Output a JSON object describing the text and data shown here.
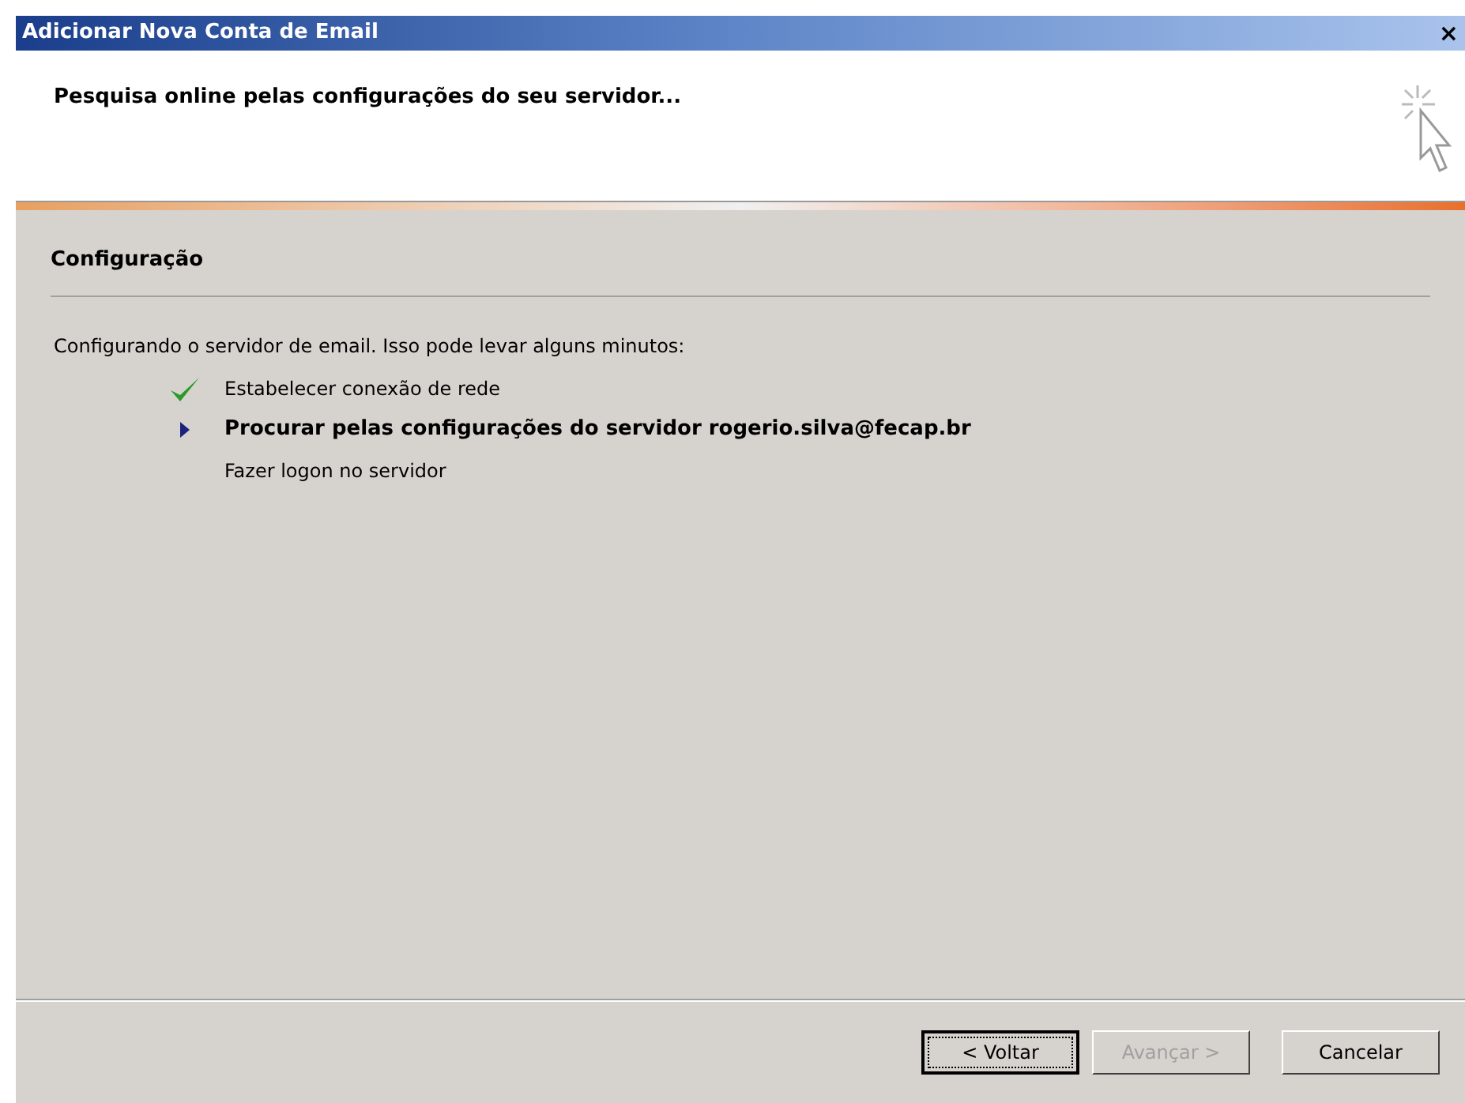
{
  "window": {
    "title": "Adicionar Nova Conta de Email",
    "close": "×"
  },
  "header": {
    "title": "Pesquisa online pelas configurações do seu servidor..."
  },
  "section": {
    "title": "Configuração"
  },
  "intro": "Configurando o servidor de email. Isso pode levar alguns minutos:",
  "steps": [
    {
      "label": "Estabelecer conexão de rede",
      "kind": "done"
    },
    {
      "label": "Procurar pelas configurações do servidor rogerio.silva@fecap.br",
      "kind": "current"
    },
    {
      "label": "Fazer logon no servidor",
      "kind": "pending"
    }
  ],
  "buttons": [
    {
      "label": "< Voltar",
      "disabled": false,
      "focused": true
    },
    {
      "label": "Avançar >",
      "disabled": true,
      "focused": false
    },
    {
      "label": "Cancelar",
      "disabled": false,
      "focused": false
    }
  ]
}
